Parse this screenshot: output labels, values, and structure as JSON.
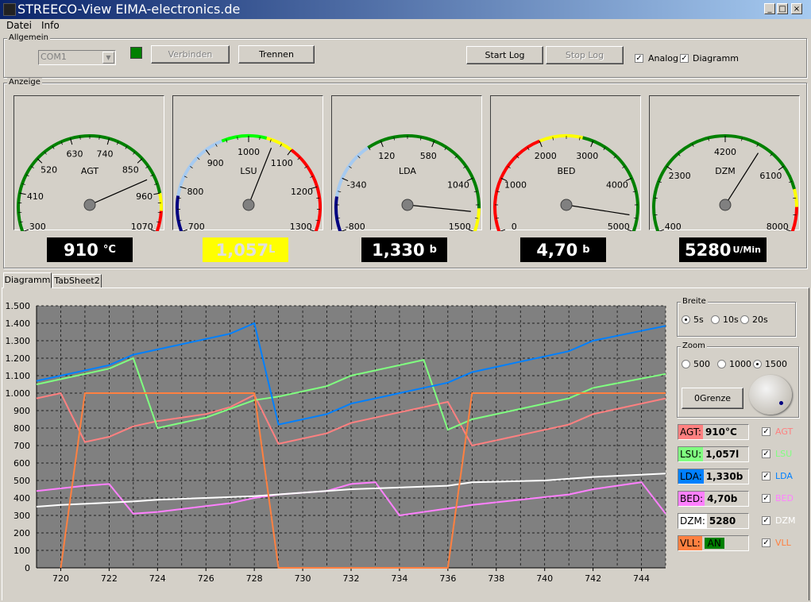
{
  "window": {
    "title": "STREECO-View EIMA-electronics.de",
    "min": "_",
    "max": "□",
    "close": "×"
  },
  "menu": [
    "Datei",
    "Info"
  ],
  "allgemein": {
    "label": "Allgemein",
    "port": "COM1",
    "connected_color": "#008000",
    "btn_verbinden": "Verbinden",
    "btn_trennen": "Trennen",
    "btn_start_log": "Start Log",
    "btn_stop_log": "Stop Log",
    "chk_analog": "Analog",
    "chk_diagramm": "Diagramm"
  },
  "anzeige": {
    "label": "Anzeige",
    "gauges": [
      {
        "name": "AGT",
        "min": 300,
        "max": 1070,
        "value": 910,
        "ticks": [
          "300",
          "410",
          "520",
          "630",
          "740",
          "850",
          "960",
          "1070"
        ],
        "zones": [
          [
            "#008000",
            300,
            960
          ],
          [
            "#ffff00",
            960,
            1010
          ],
          [
            "#ff0000",
            1010,
            1070
          ]
        ],
        "display": "910",
        "unit": "°C",
        "display_bg": "#000000",
        "display_fg": "#ffffff"
      },
      {
        "name": "LSU",
        "min": 700,
        "max": 1300,
        "value": 1057,
        "ticks": [
          "700",
          "800",
          "900",
          "1000",
          "1100",
          "1200",
          "1300"
        ],
        "zones": [
          [
            "#000080",
            700,
            780
          ],
          [
            "#a6caf0",
            780,
            940
          ],
          [
            "#00ff00",
            940,
            1040
          ],
          [
            "#ffff00",
            1040,
            1100
          ],
          [
            "#ff0000",
            1100,
            1300
          ]
        ],
        "display": "1,057",
        "unit": "L",
        "display_bg": "#ffff00",
        "display_fg": "#e0e0e0"
      },
      {
        "name": "LDA",
        "min": -800,
        "max": 1500,
        "value": 1330,
        "ticks": [
          "-800",
          "-340",
          "120",
          "580",
          "1040",
          "1500"
        ],
        "zones": [
          [
            "#000080",
            -800,
            -500
          ],
          [
            "#a6caf0",
            -500,
            0
          ],
          [
            "#008000",
            0,
            1300
          ],
          [
            "#ffff00",
            1300,
            1500
          ]
        ],
        "display": "1,330",
        "unit": "b",
        "display_bg": "#000000",
        "display_fg": "#ffffff"
      },
      {
        "name": "BED",
        "min": 0,
        "max": 5000,
        "value": 4700,
        "ticks": [
          "0",
          "1000",
          "2000",
          "3000",
          "4000",
          "5000"
        ],
        "zones": [
          [
            "#ff0000",
            0,
            2000
          ],
          [
            "#ffff00",
            2000,
            2800
          ],
          [
            "#008000",
            2800,
            5000
          ]
        ],
        "display": "4,70",
        "unit": "b",
        "display_bg": "#000000",
        "display_fg": "#ffffff"
      },
      {
        "name": "DZM",
        "min": 400,
        "max": 8000,
        "value": 5280,
        "ticks": [
          "400",
          "2300",
          "4200",
          "6100",
          "8000"
        ],
        "zones": [
          [
            "#008000",
            400,
            6800
          ],
          [
            "#ffff00",
            6800,
            7300
          ],
          [
            "#ff0000",
            7300,
            8000
          ]
        ],
        "display": "5280",
        "unit": "U/Min",
        "display_bg": "#000000",
        "display_fg": "#ffffff"
      }
    ]
  },
  "tabs": [
    "Diagramm",
    "TabSheet2"
  ],
  "chart_data": {
    "type": "line",
    "ylim": [
      0,
      1500
    ],
    "yticks": [
      "0",
      "100",
      "200",
      "300",
      "400",
      "500",
      "600",
      "700",
      "800",
      "900",
      "1.000",
      "1.100",
      "1.200",
      "1.300",
      "1.400",
      "1.500"
    ],
    "xlim": [
      719,
      745
    ],
    "xticks": [
      "720",
      "722",
      "724",
      "726",
      "728",
      "730",
      "732",
      "734",
      "736",
      "738",
      "740",
      "742",
      "744"
    ],
    "series": [
      {
        "name": "AGT",
        "color": "#ff8080",
        "points": [
          [
            719,
            970
          ],
          [
            720,
            1000
          ],
          [
            721,
            720
          ],
          [
            722,
            750
          ],
          [
            723,
            810
          ],
          [
            724,
            840
          ],
          [
            726,
            880
          ],
          [
            727,
            920
          ],
          [
            728,
            990
          ],
          [
            729,
            710
          ],
          [
            731,
            770
          ],
          [
            732,
            830
          ],
          [
            734,
            890
          ],
          [
            736,
            950
          ],
          [
            737,
            700
          ],
          [
            739,
            760
          ],
          [
            741,
            820
          ],
          [
            742,
            880
          ],
          [
            744,
            940
          ],
          [
            745,
            970
          ]
        ]
      },
      {
        "name": "LSU",
        "color": "#80ff80",
        "points": [
          [
            719,
            1050
          ],
          [
            722,
            1140
          ],
          [
            723,
            1200
          ],
          [
            724,
            800
          ],
          [
            726,
            860
          ],
          [
            728,
            960
          ],
          [
            729,
            980
          ],
          [
            731,
            1040
          ],
          [
            732,
            1100
          ],
          [
            735,
            1190
          ],
          [
            736,
            790
          ],
          [
            737,
            850
          ],
          [
            741,
            970
          ],
          [
            742,
            1030
          ],
          [
            745,
            1110
          ]
        ]
      },
      {
        "name": "LDA",
        "color": "#0080ff",
        "points": [
          [
            719,
            1070
          ],
          [
            722,
            1160
          ],
          [
            723,
            1220
          ],
          [
            724,
            1250
          ],
          [
            727,
            1340
          ],
          [
            728,
            1400
          ],
          [
            729,
            820
          ],
          [
            731,
            880
          ],
          [
            732,
            940
          ],
          [
            736,
            1060
          ],
          [
            737,
            1120
          ],
          [
            741,
            1240
          ],
          [
            742,
            1300
          ],
          [
            745,
            1385
          ]
        ]
      },
      {
        "name": "BED",
        "color": "#ff80ff",
        "points": [
          [
            719,
            440
          ],
          [
            721,
            470
          ],
          [
            722,
            480
          ],
          [
            723,
            310
          ],
          [
            724,
            320
          ],
          [
            727,
            370
          ],
          [
            728,
            400
          ],
          [
            729,
            420
          ],
          [
            731,
            440
          ],
          [
            732,
            480
          ],
          [
            733,
            490
          ],
          [
            734,
            300
          ],
          [
            736,
            340
          ],
          [
            737,
            360
          ],
          [
            741,
            420
          ],
          [
            742,
            450
          ],
          [
            744,
            490
          ],
          [
            745,
            310
          ]
        ]
      },
      {
        "name": "DZM",
        "color": "#ffffff",
        "points": [
          [
            719,
            350
          ],
          [
            720,
            360
          ],
          [
            723,
            380
          ],
          [
            724,
            390
          ],
          [
            726,
            400
          ],
          [
            728,
            410
          ],
          [
            730,
            430
          ],
          [
            732,
            450
          ],
          [
            736,
            470
          ],
          [
            737,
            490
          ],
          [
            740,
            500
          ],
          [
            742,
            520
          ],
          [
            745,
            540
          ]
        ]
      },
      {
        "name": "VLL",
        "color": "#ff8040",
        "points": [
          [
            720,
            0
          ],
          [
            721,
            1000
          ],
          [
            728,
            1000
          ],
          [
            729,
            0
          ],
          [
            736,
            0
          ],
          [
            737,
            1000
          ],
          [
            745,
            1000
          ]
        ]
      }
    ]
  },
  "side": {
    "breite": {
      "label": "Breite",
      "options": [
        "5s",
        "10s",
        "20s"
      ],
      "selected": 0
    },
    "zoom": {
      "label": "Zoom",
      "options": [
        "500",
        "1000",
        "1500"
      ],
      "selected": 2
    },
    "btn_ograenze": "0Grenze",
    "values": [
      {
        "key": "AGT:",
        "val": "910°C",
        "bg": "#ff8080",
        "chk": "AGT",
        "color": "#ff8080"
      },
      {
        "key": "LSU:",
        "val": "1,057l",
        "bg": "#80ff80",
        "chk": "LSU",
        "color": "#80ff80"
      },
      {
        "key": "LDA:",
        "val": "1,330b",
        "bg": "#0080ff",
        "chk": "LDA",
        "color": "#0080ff"
      },
      {
        "key": "BED:",
        "val": "4,70b",
        "bg": "#ff80ff",
        "chk": "BED",
        "color": "#ff80ff"
      },
      {
        "key": "DZM:",
        "val": "5280",
        "bg": "#ffffff",
        "chk": "DZM",
        "color": "#ffffff"
      },
      {
        "key": "VLL:",
        "val": "AN",
        "bg": "#ff8040",
        "chk": "VLL",
        "color": "#ff8040",
        "val_bg": "#008000"
      }
    ]
  }
}
